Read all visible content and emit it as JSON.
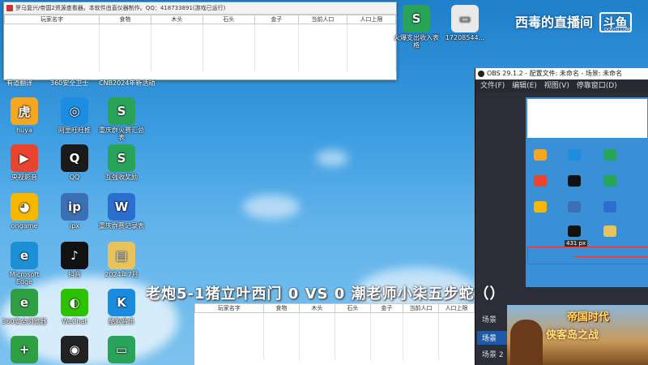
{
  "resource_window": {
    "title": "罗马复兴/帝国2资源查看器。本软件由直仪器制作。QQ：418733891(游戏已运行)",
    "columns": [
      "玩家名字",
      "食物",
      "木头",
      "石头",
      "金子",
      "当前人口",
      "人口上限"
    ]
  },
  "desktop_icons": [
    {
      "label": "huya",
      "color": "#f5a623",
      "glyph": "虎"
    },
    {
      "label": "阿里旺旺推",
      "color": "#1c8de0",
      "glyph": "◎"
    },
    {
      "label": "重庆群火赛汇总表",
      "color": "#2aa35a",
      "glyph": "S"
    },
    {
      "label": "央视影音",
      "color": "#e8442f",
      "glyph": "▶"
    },
    {
      "label": "QQ",
      "color": "#1a1a1a",
      "glyph": "Q"
    },
    {
      "label": "互强收奖励",
      "color": "#2aa35a",
      "glyph": "S"
    },
    {
      "label": "ongame",
      "color": "#f6b700",
      "glyph": "◕"
    },
    {
      "label": "ipx",
      "color": "#3d6fb5",
      "glyph": "ip"
    },
    {
      "label": "重庆群赛记录表",
      "color": "#2b6ecf",
      "glyph": "W"
    },
    {
      "label": "Microsoft Edge",
      "color": "#1d8fd6",
      "glyph": "e"
    },
    {
      "label": "抖音",
      "color": "#111111",
      "glyph": "♪"
    },
    {
      "label": "2024年7月",
      "color": "#e6c35c",
      "glyph": "▤"
    },
    {
      "label": "360安全浏览器",
      "color": "#2ea043",
      "glyph": "e"
    },
    {
      "label": "WeChat",
      "color": "#2dc100",
      "glyph": "◐"
    },
    {
      "label": "酷狗音乐",
      "color": "#1a8ce0",
      "glyph": "K"
    },
    {
      "label": "",
      "color": "#2ea043",
      "glyph": "+"
    },
    {
      "label": "",
      "color": "#222222",
      "glyph": "◉"
    },
    {
      "label": "",
      "color": "#2aa35a",
      "glyph": "▭"
    }
  ],
  "partial_labels": [
    "有道翻译",
    "360安全卫士",
    "CNB2024年新活动"
  ],
  "top_icons": [
    {
      "label": "火爆支出收入表格",
      "color": "#2aa35a",
      "glyph": "S"
    },
    {
      "label": "17208544...",
      "color": "#dddddd",
      "glyph": "▭"
    }
  ],
  "streamer": {
    "name": "西毒的直播间",
    "logo": "斗鱼",
    "logo_sub": "DOUYU.COM"
  },
  "obs": {
    "title": "OBS 29.1.2 - 配置文件: 未命名 - 场景: 未命名",
    "menu": [
      "文件(F)",
      "编辑(E)",
      "视图(V)",
      "停靠窗口(D)"
    ],
    "preview_label": "431 px",
    "scenes_header": "场景",
    "scenes": [
      "场景",
      "场景 2"
    ]
  },
  "overlay_text": "老炮5-1猪立叶西门  0 VS  0 潮老师小柒五步蛇（）",
  "bottom_table": {
    "columns": [
      "玩家名字",
      "食物",
      "木头",
      "石头",
      "金子",
      "当前人口",
      "人口上限"
    ]
  },
  "game_ad": {
    "logo": "帝国时代",
    "subtitle": "侠客岛之战"
  }
}
